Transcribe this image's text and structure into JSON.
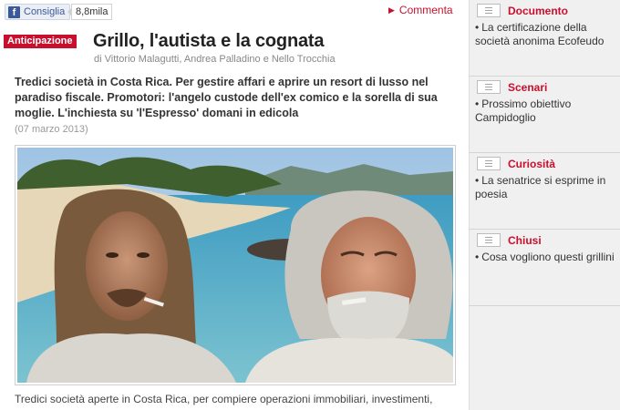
{
  "share": {
    "facebook_label": "Consiglia",
    "facebook_count": "8,8mila",
    "comments_label": "Commenta"
  },
  "article": {
    "tag": "Anticipazione",
    "title": "Grillo, l'autista e la cognata",
    "byline": "di Vittorio Malagutti, Andrea Palladino e Nello Trocchia",
    "summary": "Tredici società in Costa Rica. Per gestire affari e aprire un resort di lusso nel  paradiso fiscale. Promotori: l'angelo custode dell'ex comico e la sorella di sua moglie. L'inchiesta su 'l'Espresso' domani in edicola",
    "date": "(07 marzo 2013)",
    "body_start": "Tredici società aperte in Costa Rica, per compiere operazioni immobiliari, investimenti,"
  },
  "sidebar": {
    "boxes": [
      {
        "title": "Documento",
        "item": "La certificazione della società anonima Ecofeudo",
        "icon": "document-icon"
      },
      {
        "title": "Scenari",
        "item": "Prossimo obiettivo Campidoglio",
        "icon": "document-icon"
      },
      {
        "title": "Curiosità",
        "item": "La senatrice si esprime in poesia",
        "icon": "document-icon"
      },
      {
        "title": "Chiusi",
        "item": "Cosa vogliono questi grillini",
        "icon": "document-icon"
      }
    ]
  },
  "colors": {
    "accent_red": "#c8102e",
    "facebook_blue": "#3b5998"
  }
}
